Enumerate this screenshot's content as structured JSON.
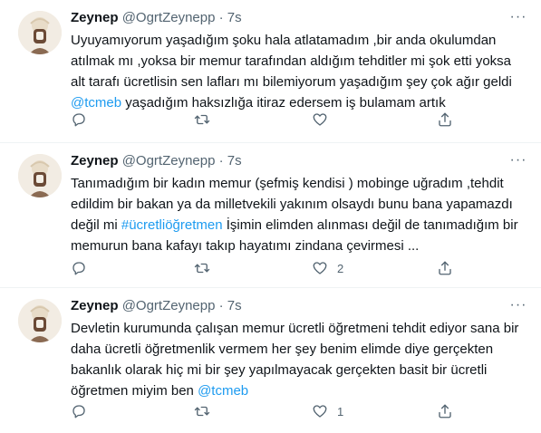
{
  "colors": {
    "link": "#1d9bf0",
    "muted": "#536471",
    "text": "#0f1419"
  },
  "icons": {
    "more": "more-horizontal-icon",
    "reply": "reply-icon",
    "retweet": "retweet-icon",
    "like": "heart-icon",
    "share": "share-icon"
  },
  "tweets": [
    {
      "name": "Zeynep",
      "meta": "@OgrtZeynepp · 7s",
      "more": "···",
      "text_a": "Uyuyamıyorum yaşadığım şoku hala atlatamadım ,bir anda okulumdan atılmak mı ,yoksa bir memur tarafından aldığım tehditler mi şok etti yoksa alt tarafı ücretlisin sen lafları mı bilemiyorum yaşadığım şey çok ağır geldi",
      "link_a": "@tcmeb",
      "text_b": " yaşadığım haksızlığa itiraz edersem iş bulamam artık",
      "like_count": ""
    },
    {
      "name": "Zeynep",
      "meta": "@OgrtZeynepp · 7s",
      "more": "···",
      "text_a": "Tanımadığım bir kadın memur (şefmiş kendisi ) mobinge uğradım ,tehdit edildim bir bakan ya da milletvekili yakınım olsaydı bunu bana yapamazdı değil mi ",
      "link_a": "#ücretliöğretmen",
      "text_b": " İşimin elimden alınması değil de tanımadığım bir memurun bana kafayı takıp hayatımı zindana çevirmesi ...",
      "like_count": "2"
    },
    {
      "name": "Zeynep",
      "meta": "@OgrtZeynepp · 7s",
      "more": "···",
      "text_a": "Devletin kurumunda çalışan memur ücretli öğretmeni tehdit ediyor sana bir daha ücretli öğretmenlik vermem her şey benim elimde diye gerçekten bakanlık olarak hiç mi bir şey yapılmayacak gerçekten basit bir ücretli öğretmen miyim ben ",
      "link_a": "@tcmeb",
      "text_b": "",
      "like_count": "1"
    }
  ]
}
